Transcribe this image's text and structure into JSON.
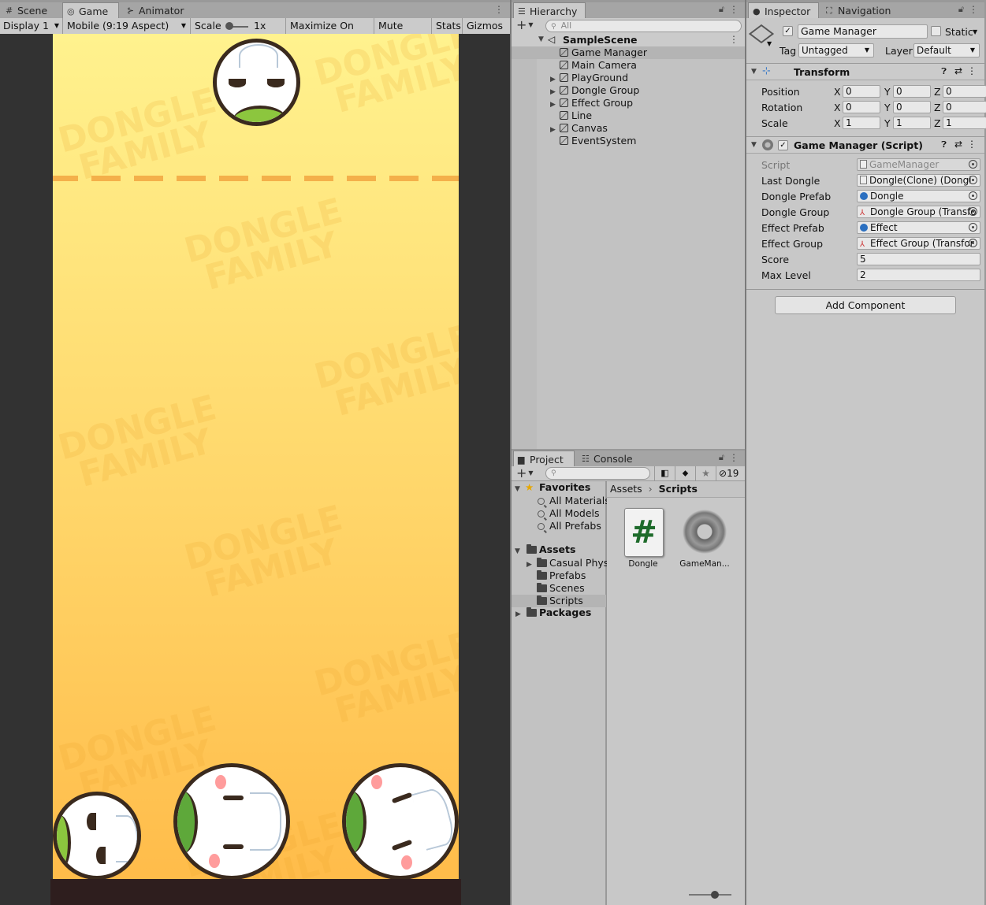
{
  "scene_tabs": {
    "scene": "Scene",
    "game": "Game",
    "animator": "Animator"
  },
  "game_toolbar": {
    "display": "Display 1",
    "aspect": "Mobile (9:19 Aspect)",
    "scale_label": "Scale",
    "scale_value": "1x",
    "maximize": "Maximize On Play",
    "mute": "Mute Audio",
    "stats": "Stats",
    "gizmos": "Gizmos"
  },
  "game_view": {
    "watermark": "DONGLE\nFAMILY"
  },
  "hierarchy": {
    "title": "Hierarchy",
    "search_placeholder": "All",
    "scene": "SampleScene",
    "items": [
      {
        "label": "Game Manager",
        "expandable": false,
        "selected": true
      },
      {
        "label": "Main Camera",
        "expandable": false
      },
      {
        "label": "PlayGround",
        "expandable": true
      },
      {
        "label": "Dongle Group",
        "expandable": true
      },
      {
        "label": "Effect Group",
        "expandable": true
      },
      {
        "label": "Line",
        "expandable": false
      },
      {
        "label": "Canvas",
        "expandable": true
      },
      {
        "label": "EventSystem",
        "expandable": false
      }
    ]
  },
  "project": {
    "tabs": {
      "project": "Project",
      "console": "Console"
    },
    "hidden_count": "19",
    "favorites": {
      "label": "Favorites",
      "items": [
        "All Materials",
        "All Models",
        "All Prefabs"
      ]
    },
    "assets": {
      "label": "Assets",
      "items": [
        "Casual Phys",
        "Prefabs",
        "Scenes",
        "Scripts"
      ]
    },
    "packages": "Packages",
    "breadcrumb": {
      "root": "Assets",
      "current": "Scripts"
    },
    "files": [
      {
        "name": "Dongle",
        "icon": "csharp-script-icon"
      },
      {
        "name": "GameMan...",
        "icon": "gear-icon"
      }
    ]
  },
  "inspector": {
    "tabs": {
      "inspector": "Inspector",
      "navigation": "Navigation"
    },
    "object_name": "Game Manager",
    "static": "Static",
    "tag_label": "Tag",
    "tag": "Untagged",
    "layer_label": "Layer",
    "layer": "Default",
    "transform": {
      "title": "Transform",
      "rows": [
        {
          "label": "Position",
          "x": "0",
          "y": "0",
          "z": "0"
        },
        {
          "label": "Rotation",
          "x": "0",
          "y": "0",
          "z": "0"
        },
        {
          "label": "Scale",
          "x": "1",
          "y": "1",
          "z": "1"
        }
      ]
    },
    "script_component": {
      "title": "Game Manager (Script)",
      "fields": [
        {
          "label": "Script",
          "value": "GameManager",
          "kind": "script"
        },
        {
          "label": "Last Dongle",
          "value": "Dongle(Clone) (Dongl",
          "kind": "script"
        },
        {
          "label": "Dongle Prefab",
          "value": "Dongle",
          "kind": "prefab"
        },
        {
          "label": "Dongle Group",
          "value": "Dongle Group (Transfo",
          "kind": "transform"
        },
        {
          "label": "Effect Prefab",
          "value": "Effect",
          "kind": "prefab"
        },
        {
          "label": "Effect Group",
          "value": "Effect Group (Transfor",
          "kind": "transform"
        },
        {
          "label": "Score",
          "value": "5",
          "kind": "text"
        },
        {
          "label": "Max Level",
          "value": "2",
          "kind": "text"
        }
      ]
    },
    "add_component": "Add Component"
  }
}
